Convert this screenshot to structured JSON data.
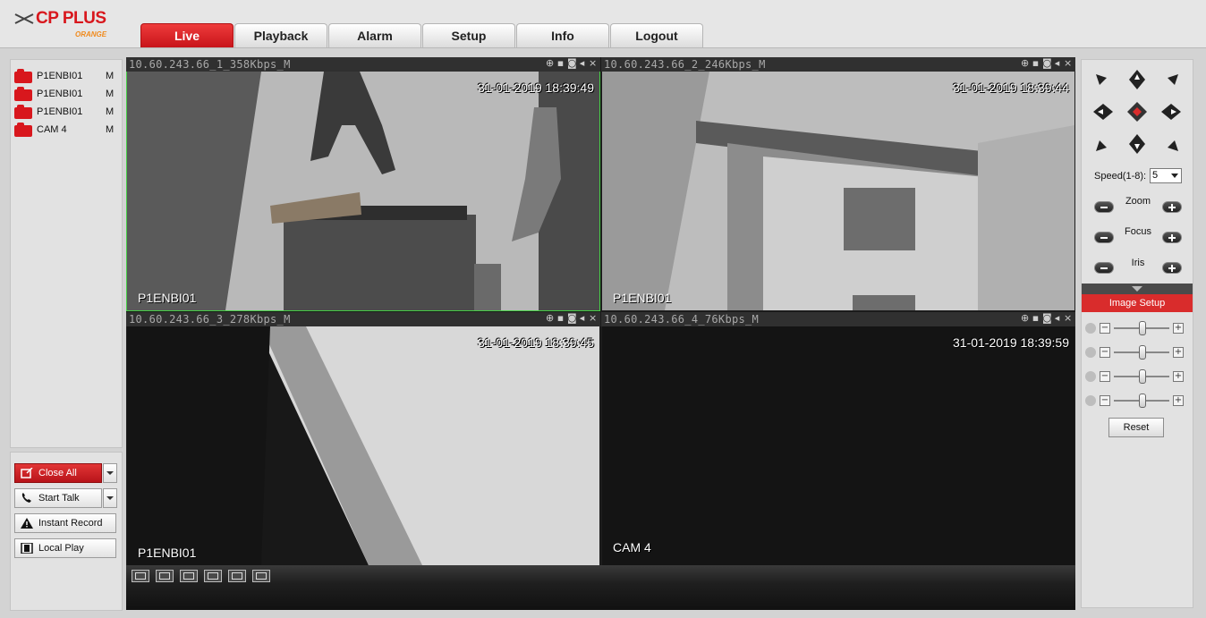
{
  "brand": {
    "name": "CP PLUS",
    "sub": "ORANGE"
  },
  "tabs": [
    "Live",
    "Playback",
    "Alarm",
    "Setup",
    "Info",
    "Logout"
  ],
  "active_tab": "Live",
  "camera_list": [
    {
      "label": "P1ENBI01",
      "mode": "M"
    },
    {
      "label": "P1ENBI01",
      "mode": "M"
    },
    {
      "label": "P1ENBI01",
      "mode": "M"
    },
    {
      "label": "CAM 4",
      "mode": "M"
    }
  ],
  "actions": {
    "close_all": "Close All",
    "start_talk": "Start Talk",
    "instant_record": "Instant Record",
    "local_play": "Local Play"
  },
  "panes": [
    {
      "title": "10.60.243.66_1_358Kbps_M",
      "timestamp": "31-01-2019 18:39:49",
      "osd": "P1ENBI01"
    },
    {
      "title": "10.60.243.66_2_246Kbps_M",
      "timestamp": "31-01-2019 18:39:44",
      "osd": "P1ENBI01"
    },
    {
      "title": "10.60.243.66_3_278Kbps_M",
      "timestamp": "31-01-2019 18:39:45",
      "osd": "P1ENBI01"
    },
    {
      "title": "10.60.243.66_4_76Kbps_M",
      "timestamp": "31-01-2019 18:39:59",
      "osd": "CAM 4"
    }
  ],
  "ptz": {
    "speed_label": "Speed(1-8):",
    "speed_value": "5",
    "zoom": "Zoom",
    "focus": "Focus",
    "iris": "Iris",
    "image_setup": "Image Setup",
    "reset": "Reset"
  },
  "colors": {
    "accent": "#d92c2c",
    "selected_outline": "#46d046"
  },
  "icons": [
    "close-all-icon",
    "phone-icon",
    "warning-icon",
    "film-icon"
  ]
}
